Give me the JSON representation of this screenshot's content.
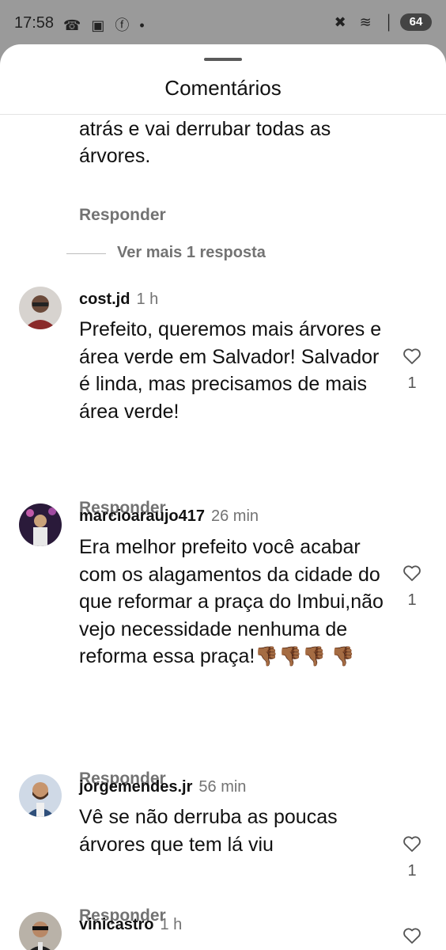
{
  "status": {
    "time": "17:58",
    "left_icons": "☎ ▣ ⓕ •",
    "right_icons": "✖ ≋ │",
    "battery": "64"
  },
  "sheet": {
    "title": "Comentários"
  },
  "partial_comment": {
    "text": "estava em obra a pouco tempo atrás e vai derrubar todas as árvores.",
    "reply": "Responder"
  },
  "view_more": "Ver mais 1 resposta",
  "comments": [
    {
      "username": "cost.jd",
      "time": "1 h",
      "text": "Prefeito, queremos mais árvores e área verde em Salvador! Salvador é linda, mas precisamos de mais área verde!",
      "likes": "1",
      "reply": "Responder"
    },
    {
      "username": "marcioaraujo417",
      "time": "26 min",
      "text": "Era melhor prefeito você acabar com os alagamentos da cidade do que reformar a praça do Imbui,não vejo necessidade nenhuma de reforma essa praça!",
      "emoji": "👎🏾👎🏾👎🏾 👎🏾",
      "likes": "1",
      "reply": "Responder"
    },
    {
      "username": "jorgemendes.jr",
      "time": "56 min",
      "text": "Vê se não derruba as poucas árvores que tem lá viu",
      "likes": "1",
      "reply": "Responder"
    },
    {
      "username": "vinicastro",
      "time": "1 h"
    }
  ],
  "colors": {
    "sheet_bg": "#ffffff",
    "scrim": "#9a9a9a",
    "secondary_text": "#737373"
  }
}
